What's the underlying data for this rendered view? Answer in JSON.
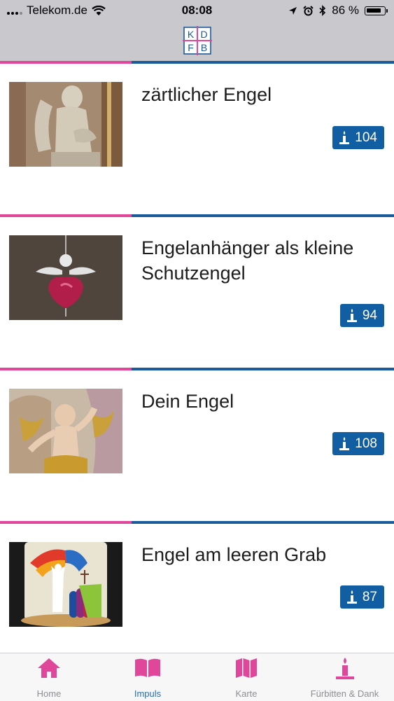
{
  "status_bar": {
    "carrier": "Telekom.de",
    "time": "08:08",
    "battery": "86 %",
    "battery_level": 0.86
  },
  "header": {
    "logo_letters": [
      "K",
      "D",
      "F",
      "B"
    ]
  },
  "items": [
    {
      "title": "zärtlicher Engel",
      "count": "104",
      "image": "angel statue photo"
    },
    {
      "title": "Engelanhänger als kleine Schutzengel",
      "count": "94",
      "image": "angel pendant photo"
    },
    {
      "title": "Dein Engel",
      "count": "108",
      "image": "baroque cherub photo"
    },
    {
      "title": "Engel am leeren Grab",
      "count": "87",
      "image": "angel candle photo"
    }
  ],
  "tabs": [
    {
      "label": "Home",
      "icon": "home-icon",
      "active": false
    },
    {
      "label": "Impuls",
      "icon": "book-icon",
      "active": true
    },
    {
      "label": "Karte",
      "icon": "map-icon",
      "active": false
    },
    {
      "label": "Fürbitten & Dank",
      "icon": "candle-icon",
      "active": false
    }
  ],
  "colors": {
    "pink": "#e0479a",
    "blue": "#1b5b9b",
    "badge": "#125ea3",
    "tab_active": "#2a6fb4",
    "tab_icon": "#e0479a"
  }
}
